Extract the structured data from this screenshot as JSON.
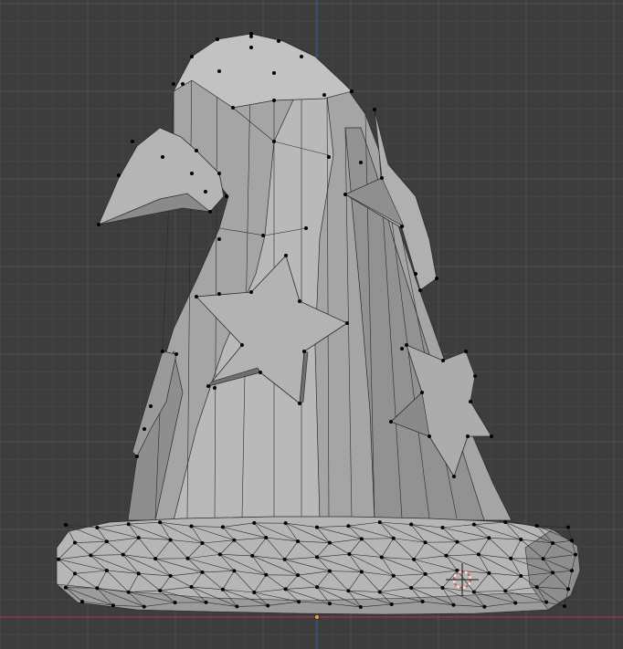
{
  "viewport": {
    "mode": "edit-mode",
    "object": "wizard-hat-mesh",
    "colors": {
      "background": "#3d3d3d",
      "grid_minor": "#474747",
      "grid_major": "#525252",
      "axis_x": "#9b3a44",
      "axis_z": "#3a5a95",
      "mesh_light": "#bdbdbd",
      "mesh_mid": "#a5a5a5",
      "mesh_dark": "#7d7d7d",
      "edge": "#2b2b2b",
      "vertex": "#000000",
      "cursor_red": "#d94f4f",
      "cursor_white": "#f0f0f0",
      "origin": "#e8a23a"
    }
  }
}
